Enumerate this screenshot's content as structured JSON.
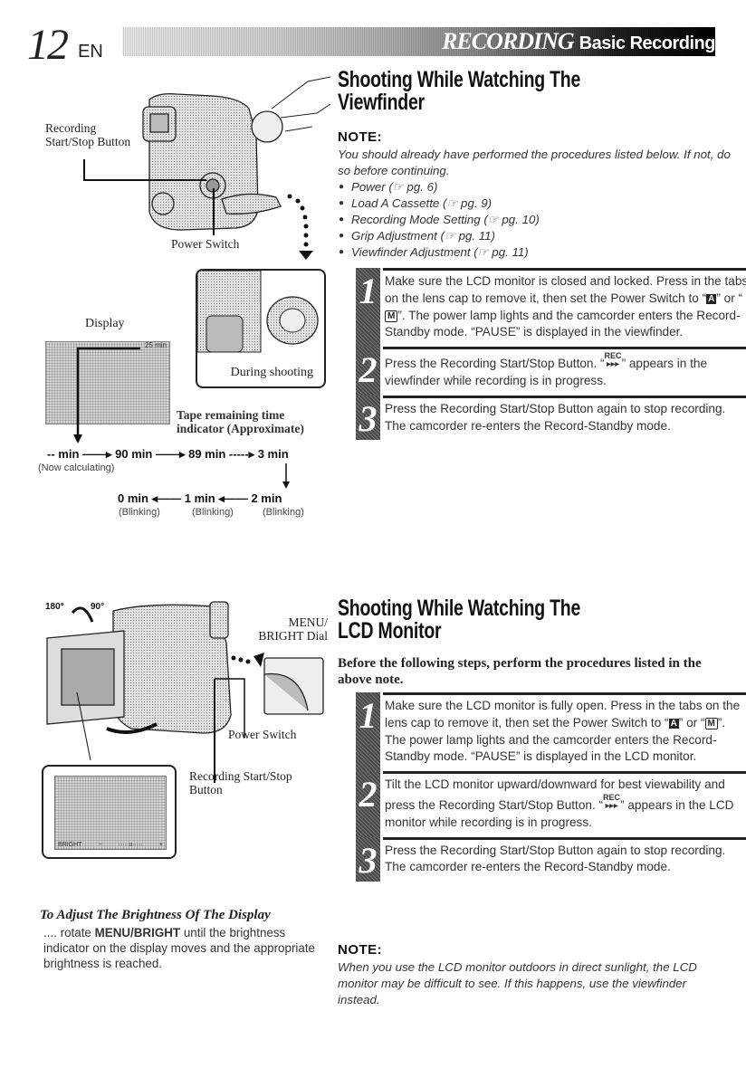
{
  "header": {
    "page_number": "12",
    "language": "EN",
    "section": "RECORDING",
    "subsection": "Basic Recording"
  },
  "viewfinder_section": {
    "title_line1": "Shooting While Watching The",
    "title_line2": "Viewfinder",
    "note_label": "NOTE:",
    "note_text": "You should already have performed the procedures listed below. If not, do so before continuing.",
    "prerequisites": [
      "Power (☞ pg. 6)",
      "Load A Cassette (☞ pg. 9)",
      "Recording Mode Setting (☞ pg. 10)",
      "Grip Adjustment (☞ pg. 11)",
      "Viewfinder Adjustment (☞ pg. 11)"
    ],
    "steps": [
      {
        "number": "1",
        "text_a": "Make sure the LCD monitor is closed and locked. Press in the tabs on the lens cap to remove it, then set the Power Switch to “",
        "glyph_a": "A",
        "text_b": "” or “",
        "glyph_m": "M",
        "text_c": "”. The power lamp lights and the camcorder enters the Record-Standby mode. “PAUSE” is displayed in the viewfinder."
      },
      {
        "number": "2",
        "text_a": "Press the Recording Start/Stop Button. “",
        "rec_top": "REC",
        "rec_bottom": "▶▶▶",
        "text_b": "” appears in the viewfinder while recording is in progress."
      },
      {
        "number": "3",
        "text": "Press the Recording Start/Stop Button again to stop recording. The camcorder re-enters the Record-Standby mode."
      }
    ]
  },
  "lcd_section": {
    "title_line1": "Shooting While Watching The",
    "title_line2": "LCD Monitor",
    "intro": "Before the following steps, perform the procedures listed in the above note.",
    "steps": [
      {
        "number": "1",
        "text_a": "Make sure the LCD monitor is fully open. Press in the tabs on the lens cap to remove it, then set the Power Switch to “",
        "glyph_a": "A",
        "text_b": "” or “",
        "glyph_m": "M",
        "text_c": "”.  The power lamp lights and the camcorder enters the Record-Standby mode. “PAUSE” is displayed in the LCD monitor."
      },
      {
        "number": "2",
        "text_a": "Tilt the LCD monitor upward/downward for best viewability and press the Recording Start/Stop Button. “",
        "rec_top": "REC",
        "rec_bottom": "▶▶▶",
        "text_b": "” appears in the LCD monitor while recording is in progress."
      },
      {
        "number": "3",
        "text": "Press the Recording Start/Stop Button again to stop recording. The camcorder re-enters the Record-Standby mode."
      }
    ],
    "note_label": "NOTE:",
    "note_text": "When you use the LCD monitor outdoors in direct sunlight, the LCD monitor may be difficult to see. If this happens, use the viewfinder instead."
  },
  "figure_top": {
    "label_rec_button_line1": "Recording",
    "label_rec_button_line2": "Start/Stop Button",
    "label_power_switch": "Power Switch",
    "label_display": "Display",
    "display_readout": "25 min",
    "label_during_shooting": "During shooting",
    "label_tape_line1": "Tape remaining time",
    "label_tape_line2": "indicator (Approximate)",
    "sequence_row1": [
      "-- min",
      "90 min",
      "89 min",
      "3 min"
    ],
    "note_now_calculating": "(Now calculating)",
    "sequence_row2": [
      "0 min",
      "1 min",
      "2 min"
    ],
    "blinking": "(Blinking)"
  },
  "figure_bottom": {
    "angle_180": "180°",
    "angle_90": "90°",
    "label_menu_line1": "MENU/",
    "label_menu_line2": "BRIGHT Dial",
    "label_power_switch": "Power Switch",
    "label_rec_line1": "Recording Start/Stop",
    "label_rec_line2": "Button",
    "lcd_bright_label": "BRIGHT",
    "lcd_minus": "−",
    "lcd_plus": "+"
  },
  "adjust": {
    "title": "To Adjust The Brightness Of The Display",
    "prefix": "....",
    "lead": "rotate",
    "control": "MENU/BRIGHT",
    "rest": "until the brightness indicator on the display moves and the appropriate brightness is reached."
  }
}
